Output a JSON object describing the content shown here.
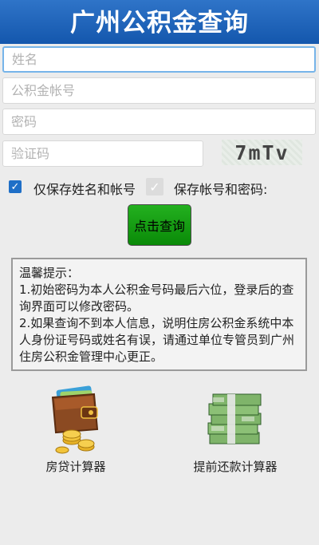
{
  "header": {
    "title": "广州公积金查询"
  },
  "form": {
    "name_placeholder": "姓名",
    "account_placeholder": "公积金帐号",
    "password_placeholder": "密码",
    "captcha_placeholder": "验证码",
    "captcha_text": "7mTv"
  },
  "options": {
    "save_name_account_label": "仅保存姓名和帐号",
    "save_account_password_label": "保存帐号和密码:"
  },
  "actions": {
    "query_label": "点击查询"
  },
  "tips": {
    "title": "温馨提示：",
    "items": [
      "1.初始密码为本人公积金号码最后六位，登录后的查询界面可以修改密码。",
      "2.如果查询不到本人信息，说明住房公积金系统中本人身份证号码或姓名有误，请通过单位专管员到广州住房公积金管理中心更正。"
    ]
  },
  "tools": [
    {
      "label": "房贷计算器",
      "icon": "wallet-coins-icon"
    },
    {
      "label": "提前还款计算器",
      "icon": "money-stack-icon"
    }
  ],
  "colors": {
    "header_bg": "#1e64bd",
    "query_button": "#14a012",
    "checkbox_on": "#1f6fc7"
  }
}
